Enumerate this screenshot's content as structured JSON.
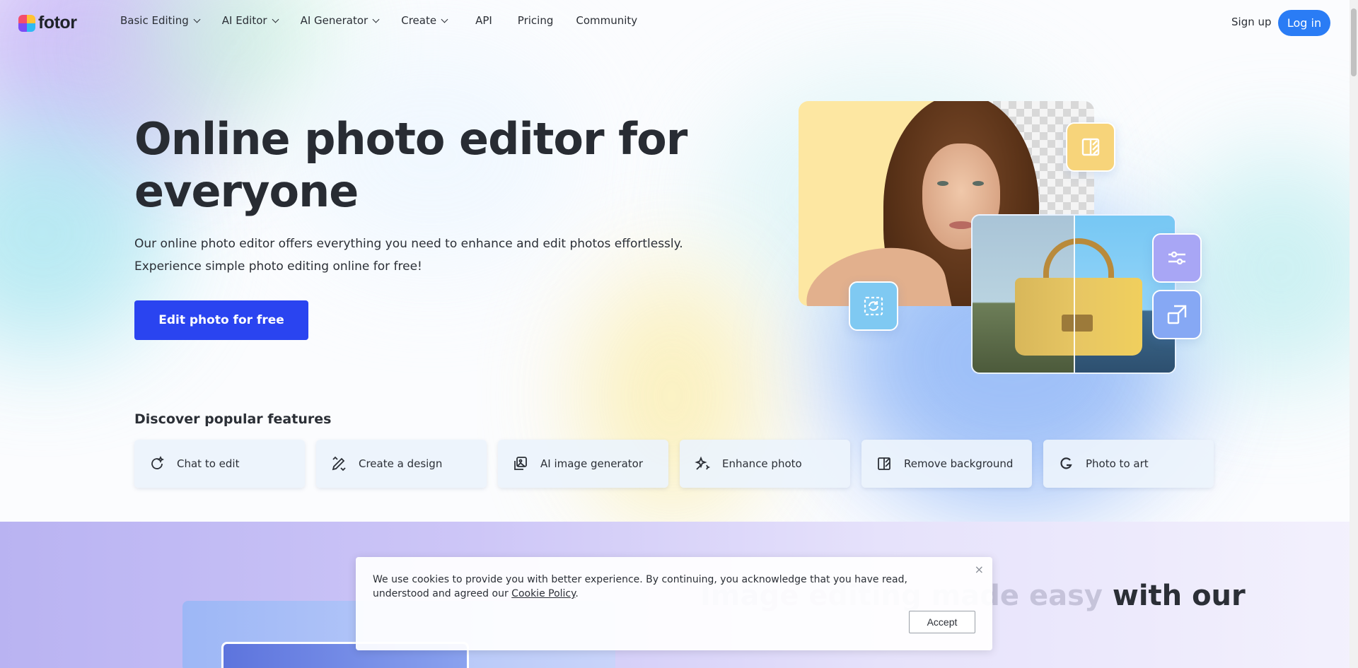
{
  "brand": {
    "name": "fotor"
  },
  "nav": {
    "items": [
      {
        "label": "Basic Editing",
        "dropdown": true
      },
      {
        "label": "AI Editor",
        "dropdown": true
      },
      {
        "label": "AI Generator",
        "dropdown": true
      },
      {
        "label": "Create",
        "dropdown": true
      },
      {
        "label": "API",
        "dropdown": false
      },
      {
        "label": "Pricing",
        "dropdown": false
      },
      {
        "label": "Community",
        "dropdown": false
      }
    ],
    "signup": "Sign up",
    "login": "Log in"
  },
  "hero": {
    "title_line1": "Online photo editor for",
    "title_line2": "everyone",
    "subtitle_line1": "Our online photo editor offers everything you need to enhance and edit photos effortlessly.",
    "subtitle_line2": "Experience simple photo editing online for free!",
    "cta": "Edit photo for free"
  },
  "features": {
    "title": "Discover popular features",
    "items": [
      {
        "label": "Chat to edit",
        "icon": "chat-edit-icon"
      },
      {
        "label": "Create a design",
        "icon": "design-pen-icon"
      },
      {
        "label": "AI image generator",
        "icon": "ai-image-icon"
      },
      {
        "label": "Enhance photo",
        "icon": "sparkle-icon"
      },
      {
        "label": "Remove background",
        "icon": "remove-bg-icon"
      },
      {
        "label": "Photo to art",
        "icon": "art-brush-icon"
      }
    ]
  },
  "lower": {
    "heading_visible": "with our"
  },
  "cookie": {
    "text": "We use cookies to provide you with better experience. By continuing, you acknowledge that you have read, understood and agreed our",
    "link": "Cookie Policy",
    "end": ".",
    "accept": "Accept",
    "close": "×"
  },
  "colors": {
    "primary_cta": "#2a44f0",
    "login_button": "#2a7cf5",
    "heading_text": "#282c33"
  }
}
